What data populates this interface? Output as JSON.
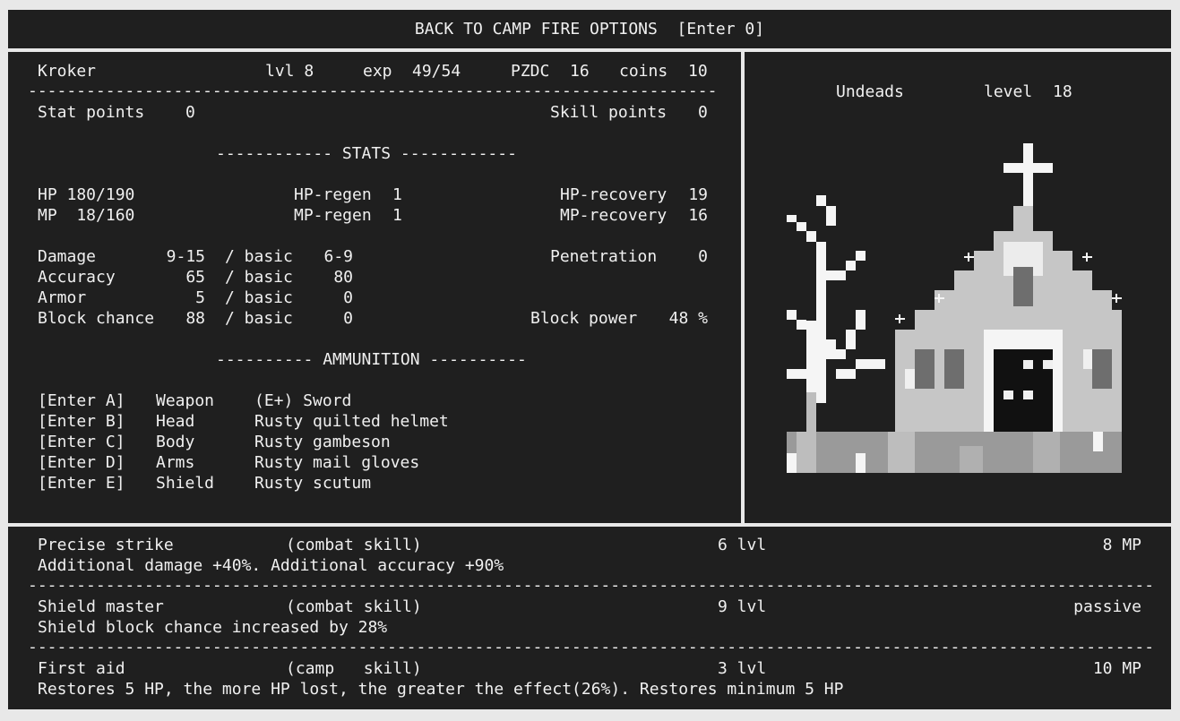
{
  "back_button": {
    "label": "BACK TO CAMP FIRE OPTIONS  [Enter 0]"
  },
  "character": {
    "name": "Kroker",
    "level": "lvl 8",
    "exp_label": "exp",
    "exp_value": "49/54",
    "pzdc_label": "PZDC",
    "pzdc_value": "16",
    "coins_label": "coins",
    "coins_value": "10"
  },
  "points": {
    "stat_label": "Stat points",
    "stat_value": "0",
    "skill_label": "Skill points",
    "skill_value": "0"
  },
  "stats_header": "------------ STATS ------------",
  "stats": {
    "hp": "HP 180/190",
    "mp": "MP  18/160",
    "hp_regen_label": "HP-regen",
    "hp_regen_value": "1",
    "mp_regen_label": "MP-regen",
    "mp_regen_value": "1",
    "hp_recovery_label": "HP-recovery",
    "hp_recovery_value": "19",
    "mp_recovery_label": "MP-recovery",
    "mp_recovery_value": "16",
    "damage": {
      "label": "Damage",
      "value": "9-15",
      "basic_label": "/ basic",
      "basic": "6-9"
    },
    "accuracy": {
      "label": "Accuracy",
      "value": "65",
      "basic_label": "/ basic",
      "basic": "80"
    },
    "armor": {
      "label": "Armor",
      "value": "5",
      "basic_label": "/ basic",
      "basic": "0"
    },
    "block": {
      "label": "Block chance",
      "value": "88",
      "basic_label": "/ basic",
      "basic": "0"
    },
    "penetration_label": "Penetration",
    "penetration_value": "0",
    "block_power_label": "Block power",
    "block_power_value": "48 %"
  },
  "ammo_header": "---------- AMMUNITION ----------",
  "ammunition": [
    {
      "key": "[Enter A]",
      "slot": "Weapon",
      "item": "(E+) Sword"
    },
    {
      "key": "[Enter B]",
      "slot": "Head",
      "item": "Rusty quilted helmet"
    },
    {
      "key": "[Enter C]",
      "slot": "Body",
      "item": "Rusty gambeson"
    },
    {
      "key": "[Enter D]",
      "slot": "Arms",
      "item": "Rusty mail gloves"
    },
    {
      "key": "[Enter E]",
      "slot": "Shield",
      "item": "Rusty scutum"
    }
  ],
  "location": {
    "name": "Undeads",
    "level_label": "level",
    "level_value": "18",
    "image_icon": "chapel-pixel-art-icon"
  },
  "skills": [
    {
      "name": "Precise strike",
      "type": "(combat skill)",
      "level": "6 lvl",
      "cost": "8 MP",
      "description": "Additional damage +40%. Additional accuracy +90%"
    },
    {
      "name": "Shield master",
      "type": "(combat skill)",
      "level": "9 lvl",
      "cost": "passive",
      "description": "Shield block chance increased by 28%"
    },
    {
      "name": "First aid",
      "type": "(camp   skill)",
      "level": "3 lvl",
      "cost": "10 MP",
      "description": "Restores 5 HP, the more HP lost, the greater the effect(26%). Restores minimum 5 HP"
    }
  ],
  "colors": {
    "background": "#1f1f1f",
    "text": "#f0f0f0",
    "frame": "#e8e8e8"
  }
}
